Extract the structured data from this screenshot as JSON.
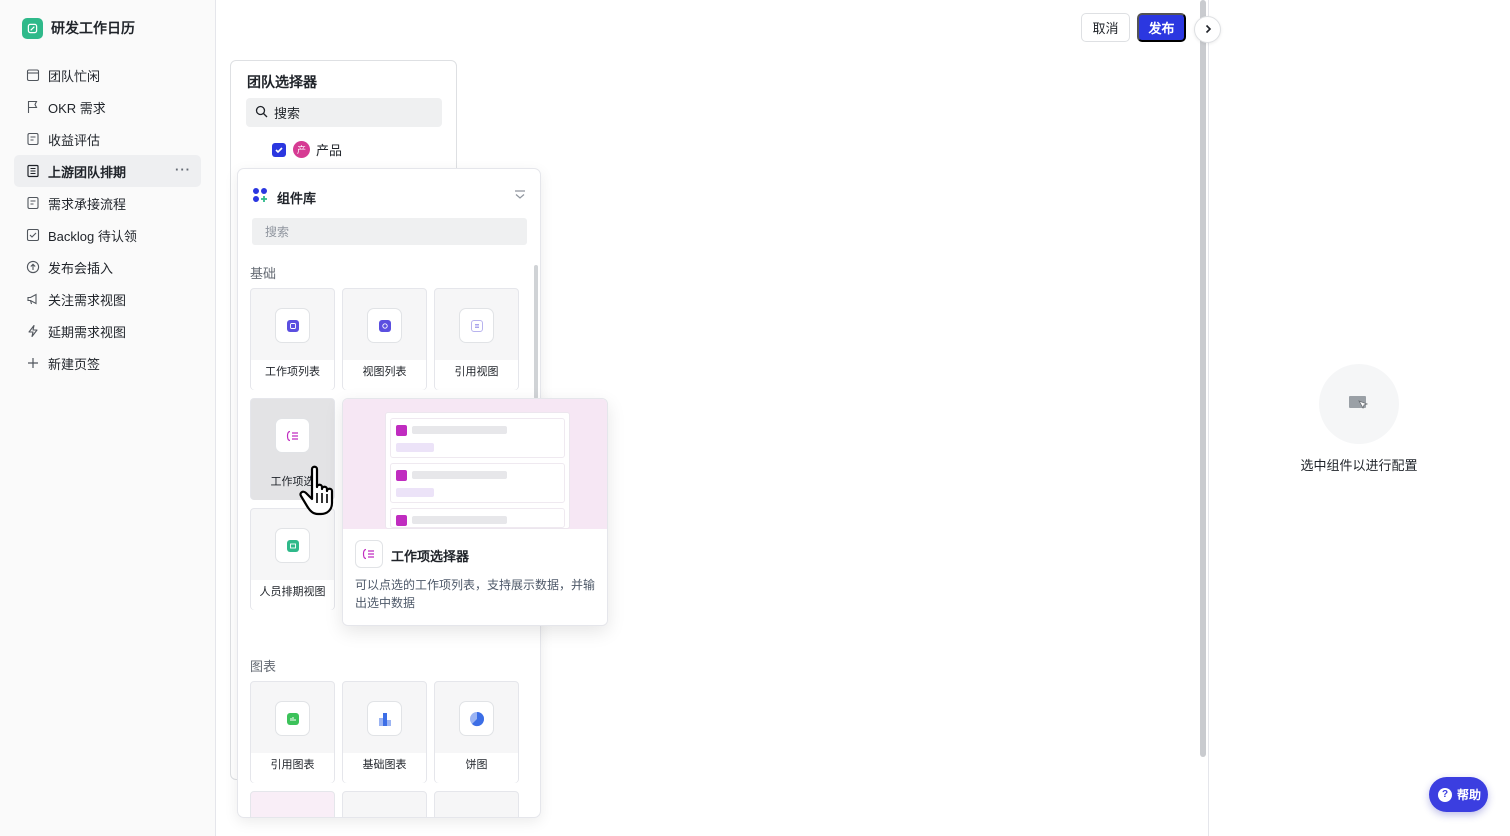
{
  "app": {
    "title": "研发工作日历"
  },
  "sidebar": {
    "items": [
      {
        "label": "团队忙闲",
        "icon": "calendar-icon"
      },
      {
        "label": "OKR 需求",
        "icon": "flag-icon"
      },
      {
        "label": "收益评估",
        "icon": "doc-icon"
      },
      {
        "label": "上游团队排期",
        "icon": "list-doc-icon",
        "active": true,
        "more": "···"
      },
      {
        "label": "需求承接流程",
        "icon": "doc-icon"
      },
      {
        "label": "Backlog 待认领",
        "icon": "checkbox-icon"
      },
      {
        "label": "发布会插入",
        "icon": "upload-circle-icon"
      },
      {
        "label": "关注需求视图",
        "icon": "megaphone-icon"
      },
      {
        "label": "延期需求视图",
        "icon": "lightning-icon"
      },
      {
        "label": "新建页签",
        "icon": "plus-icon"
      }
    ]
  },
  "toolbar": {
    "cancel": "取消",
    "publish": "发布"
  },
  "team_selector": {
    "title": "团队选择器",
    "search_label": "搜索",
    "option": {
      "label": "产品",
      "checked": true,
      "avatar_text": "产"
    }
  },
  "library": {
    "title": "组件库",
    "search_placeholder": "搜索",
    "sections": [
      {
        "title": "基础",
        "items": [
          "工作项列表",
          "视图列表",
          "引用视图",
          "工作项选",
          "人员排期视图"
        ]
      },
      {
        "title": "图表",
        "items": [
          "引用图表",
          "基础图表",
          "饼图"
        ]
      }
    ]
  },
  "preview": {
    "title": "工作项选择器",
    "description": "可以点选的工作项列表，支持展示数据，并输出选中数据"
  },
  "config_panel": {
    "empty_text": "选中组件以进行配置"
  },
  "help": {
    "label": "帮助"
  },
  "colors": {
    "brand": "#2b37e0",
    "logo": "#2fb98a",
    "accent_pink": "#c02cc0"
  }
}
